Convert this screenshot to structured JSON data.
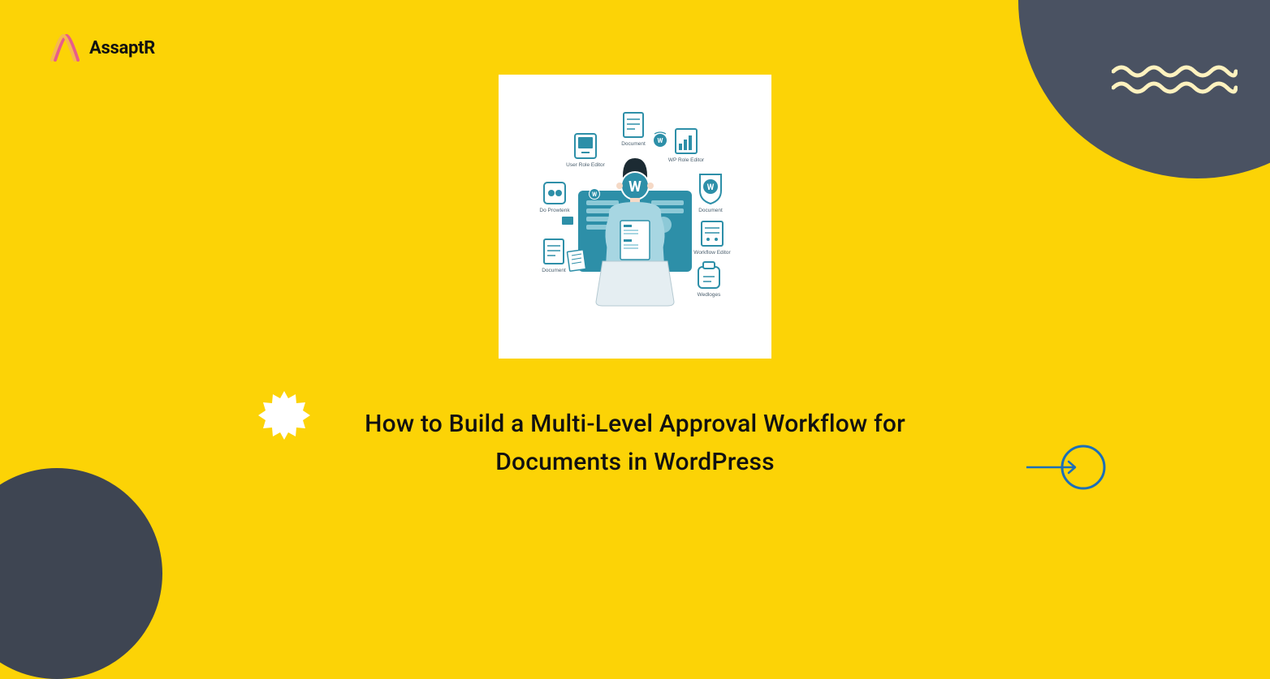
{
  "brand": {
    "name": "AssaptR"
  },
  "title": "How to Build a Multi-Level Approval Workflow for Documents in WordPress",
  "illustration": {
    "labels": {
      "userRoleEditor": "User Role Editor",
      "documentTop": "Document",
      "wpRoleEditor": "WP Role Editor",
      "doProwtenk": "Do Prowtenk",
      "documentRight": "Document",
      "documentLeft": "Document",
      "workflowEditor": "Workflow Editor",
      "wedloges": "Wedloges"
    }
  },
  "colors": {
    "background": "#FCD306",
    "darkCircle": "#4A5262",
    "darkCircle2": "#3E4552",
    "accent": "#1C6FB8",
    "illTeal": "#2D8FA8"
  }
}
